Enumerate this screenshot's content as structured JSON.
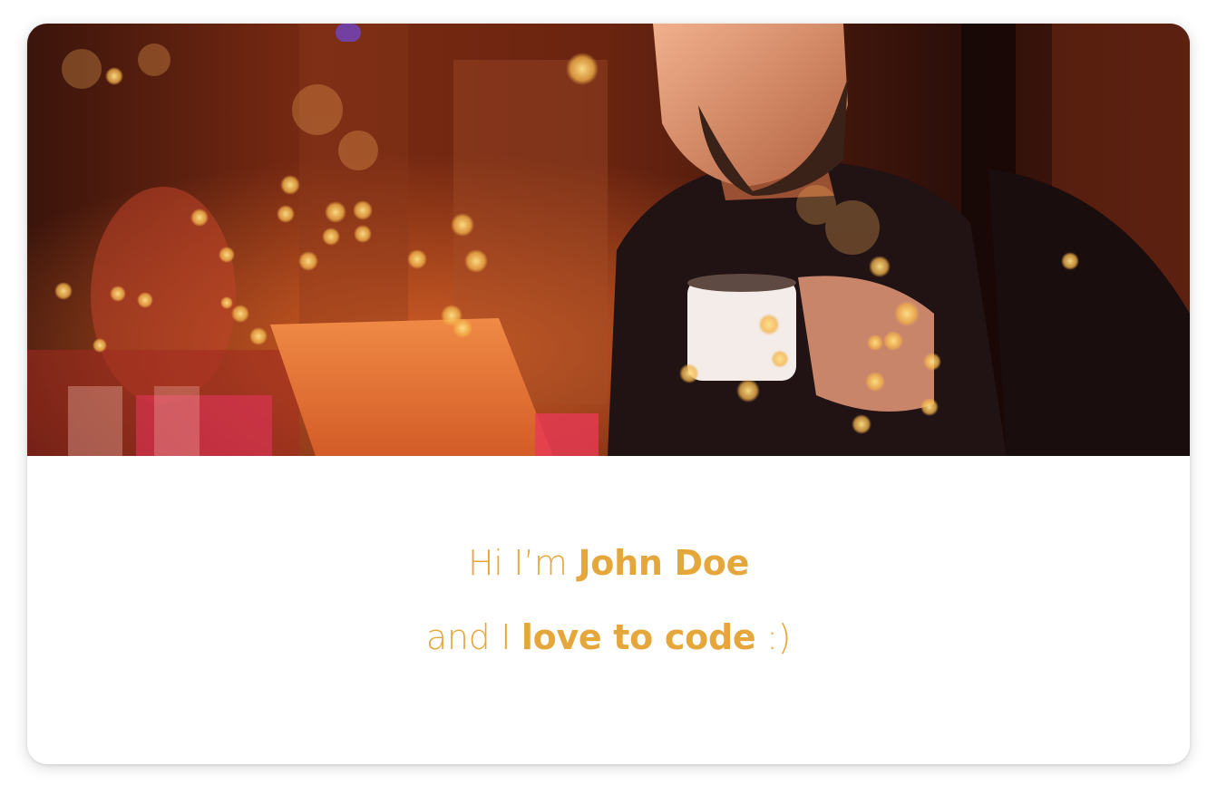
{
  "theme": {
    "accent": "#e5a73c",
    "card_background": "#ffffff",
    "page_background": "#ffffff"
  },
  "hero": {
    "icon": "hero-photo"
  },
  "intro": {
    "line1": {
      "prefix": "Hi I’m ",
      "name": "John Doe"
    },
    "line2": {
      "prefix": "and I ",
      "emphasis": "love to code",
      "suffix": " :)"
    }
  }
}
